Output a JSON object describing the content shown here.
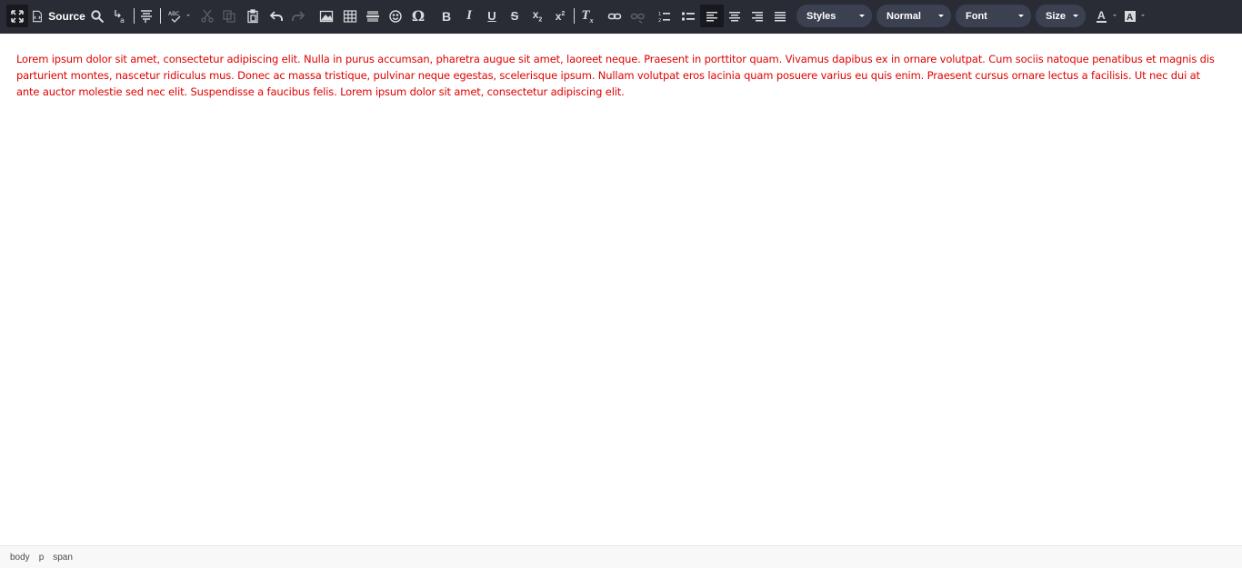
{
  "toolbar": {
    "source_label": "Source",
    "combos": {
      "styles": "Styles",
      "format": "Normal",
      "font": "Font",
      "size": "Size"
    },
    "icons": [
      "maximize-icon",
      "source-icon",
      "find-icon",
      "replace-icon",
      "select-all-icon",
      "spellcheck-icon",
      "cut-icon",
      "copy-icon",
      "paste-icon",
      "undo-icon",
      "redo-icon",
      "image-icon",
      "table-icon",
      "horizontal-line-icon",
      "smiley-icon",
      "special-char-icon",
      "bold-icon",
      "italic-icon",
      "underline-icon",
      "strikethrough-icon",
      "subscript-icon",
      "superscript-icon",
      "remove-format-icon",
      "link-icon",
      "unlink-icon",
      "numbered-list-icon",
      "bulleted-list-icon",
      "align-left-icon",
      "align-center-icon",
      "align-right-icon",
      "justify-icon",
      "text-color-icon",
      "background-color-icon"
    ]
  },
  "editor": {
    "text": "Lorem ipsum dolor sit amet, consectetur adipiscing elit. Nulla in purus accumsan, pharetra augue sit amet, laoreet neque. Praesent in porttitor quam. Vivamus dapibus ex in ornare volutpat. Cum sociis natoque penatibus et magnis dis parturient montes, nascetur ridiculus mus. Donec ac massa tristique, pulvinar neque egestas, scelerisque ipsum. Nullam volutpat eros lacinia quam posuere varius eu quis enim. Praesent cursus ornare lectus a facilisis. Ut nec dui at ante auctor molestie sed nec elit. Suspendisse a faucibus felis. Lorem ipsum dolor sit amet, consectetur adipiscing elit.",
    "text_color": "#e00000"
  },
  "statusbar": {
    "path": [
      "body",
      "p",
      "span"
    ]
  },
  "colors": {
    "toolbar_bg": "#292c34",
    "combo_bg": "#3b4150",
    "icon": "#d9dadc"
  }
}
